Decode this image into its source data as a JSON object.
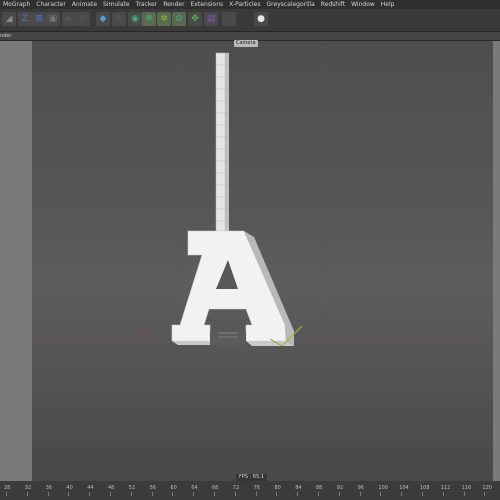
{
  "menu": [
    "MoGraph",
    "Character",
    "Animate",
    "Simulate",
    "Tracker",
    "Render",
    "Extensions",
    "X-Particles",
    "Greyscalegorilla",
    "Redshift",
    "Window",
    "Help"
  ],
  "toolbar_icons": [
    {
      "name": "axis-lock-icon",
      "glyph": "◢",
      "color": "#8a8a8a"
    },
    {
      "name": "z-axis-icon",
      "glyph": "Z",
      "color": "#4a78c8"
    },
    {
      "name": "coordinate-system-icon",
      "glyph": "⊞",
      "color": "#4a78c8"
    },
    {
      "name": "render-region-icon",
      "glyph": "▣",
      "color": "#777"
    },
    {
      "name": "render-view-icon",
      "glyph": "▶",
      "color": "#555"
    },
    {
      "name": "render-settings-icon",
      "glyph": "⚙",
      "color": "#555"
    },
    {
      "name": "cube-icon",
      "glyph": "◆",
      "color": "#4aa3e0"
    },
    {
      "name": "pen-spline-icon",
      "glyph": "✎",
      "color": "#5a5a5a"
    },
    {
      "name": "nurbs-icon",
      "glyph": "◉",
      "color": "#46b070"
    },
    {
      "name": "array-icon",
      "glyph": "❋",
      "color": "#3fb060"
    },
    {
      "name": "deformer-icon",
      "glyph": "✲",
      "color": "#7cc040"
    },
    {
      "name": "environment-icon",
      "glyph": "✿",
      "color": "#3fa070"
    },
    {
      "name": "scene-icon",
      "glyph": "✤",
      "color": "#50b050"
    },
    {
      "name": "floor-icon",
      "glyph": "▤",
      "color": "#7a5ac8"
    },
    {
      "name": "camera-icon",
      "glyph": "■",
      "color": "#4a4a4a"
    },
    {
      "name": "light-icon",
      "glyph": "●",
      "color": "#e8e8e8"
    }
  ],
  "subbar_label": "nder",
  "viewport": {
    "camera_label": "Camera",
    "fps_label": "FPS : 65.1"
  },
  "timeline": {
    "labels": [
      "28",
      "32",
      "36",
      "40",
      "44",
      "48",
      "52",
      "56",
      "60",
      "64",
      "68",
      "72",
      "76",
      "80",
      "84",
      "88",
      "92",
      "96",
      "100",
      "104",
      "108",
      "112",
      "116",
      "120"
    ]
  }
}
